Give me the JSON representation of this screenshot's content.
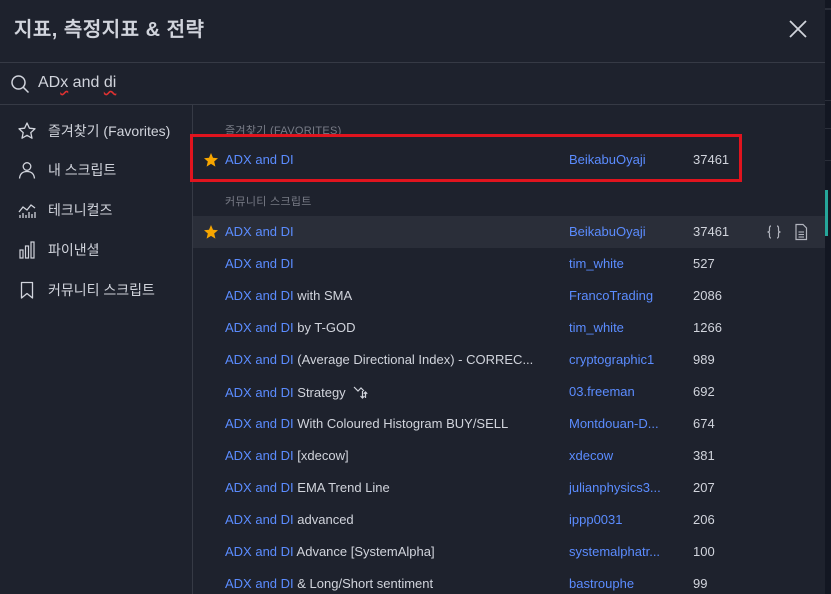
{
  "dialog": {
    "title": "지표, 측정지표 & 전략"
  },
  "search": {
    "value_part1": "AD",
    "value_part2": "x",
    "value_part3": " and ",
    "value_part4": "di",
    "value": "ADx and di"
  },
  "sidebar": {
    "items": [
      {
        "label": "즐겨찾기 (Favorites)",
        "icon": "star-outline-icon"
      },
      {
        "label": "내 스크립트",
        "icon": "user-icon"
      },
      {
        "label": "테크니컬즈",
        "icon": "technicals-chart-icon"
      },
      {
        "label": "파이낸셜",
        "icon": "bar-chart-icon"
      },
      {
        "label": "커뮤니티 스크립트",
        "icon": "bookmark-icon"
      }
    ]
  },
  "sections": {
    "favorites": "즐겨찾기 (FAVORITES)",
    "community": "커뮤니티 스크립트"
  },
  "favorites": [
    {
      "match": "ADX and DI",
      "rest": "",
      "author": "BeikabuOyaji",
      "count": "37461"
    }
  ],
  "community": [
    {
      "match": "ADX and DI",
      "rest": "",
      "author": "BeikabuOyaji",
      "count": "37461"
    },
    {
      "match": "ADX and DI",
      "rest": "",
      "author": "tim_white",
      "count": "527"
    },
    {
      "match": "ADX and DI",
      "rest": " with SMA",
      "author": "FrancoTrading",
      "count": "2086"
    },
    {
      "match": "ADX and DI",
      "rest": " by T-GOD",
      "author": "tim_white",
      "count": "1266"
    },
    {
      "match": "ADX and DI",
      "rest": " (Average Directional Index) - CORREC...",
      "author": "cryptographic1",
      "count": "989"
    },
    {
      "match": "ADX and DI",
      "rest": " Strategy",
      "author": "03.freeman",
      "count": "692"
    },
    {
      "match": "ADX and DI",
      "rest": " With Coloured Histogram BUY/SELL",
      "author": "Montdouan-D...",
      "count": "674"
    },
    {
      "match": "ADX and DI",
      "rest": " [xdecow]",
      "author": "xdecow",
      "count": "381"
    },
    {
      "match": "ADX and DI",
      "rest": " EMA Trend Line",
      "author": "julianphysics3...",
      "count": "207"
    },
    {
      "match": "ADX and DI",
      "rest": " advanced",
      "author": "ippp0031",
      "count": "206"
    },
    {
      "match": "ADX and DI",
      "rest": " Advance [SystemAlpha]",
      "author": "systemalphatr...",
      "count": "100"
    },
    {
      "match": "ADX and DI",
      "rest": " & Long/Short sentiment",
      "author": "bastrouphe",
      "count": "99"
    }
  ],
  "colors": {
    "background": "#1e222d",
    "accent_blue": "#5b8cff",
    "star": "#f7a600",
    "highlight_box": "#e0141e"
  }
}
